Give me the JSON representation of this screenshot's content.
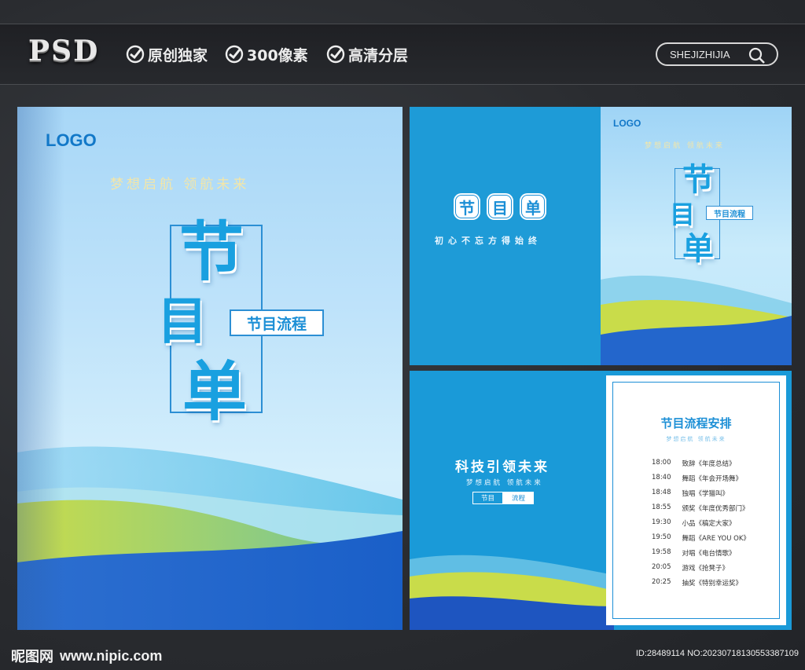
{
  "header": {
    "psd_label": "PSD",
    "features": [
      "原创独家",
      "300像素",
      "高清分层"
    ],
    "search_text": "SHEJIZHIJIA"
  },
  "cover": {
    "logo": "LOGO",
    "slogan": "梦想启航  领航未来",
    "chars": [
      "节",
      "目",
      "单"
    ],
    "tag": "节目流程"
  },
  "spread": {
    "left_chars": [
      "节",
      "目",
      "单"
    ],
    "left_slogan": "初心不忘方得始终",
    "logo": "LOGO",
    "slogan": "梦想启航  领航未来",
    "chars": [
      "节",
      "目",
      "单"
    ],
    "tag": "节目流程"
  },
  "inner": {
    "headline": "科技引领未来",
    "sub": "梦想启航  领航未来",
    "tab_a": "节目",
    "tab_b": "流程",
    "schedule_title": "节目流程安排",
    "schedule_sub": "梦想启航  领航未来",
    "rows": [
      {
        "time": "18:00",
        "item": "致辞《年度总结》"
      },
      {
        "time": "18:40",
        "item": "舞蹈《年会开场舞》"
      },
      {
        "time": "18:48",
        "item": "独唱《学猫叫》"
      },
      {
        "time": "18:55",
        "item": "颁奖《年度优秀部门》"
      },
      {
        "time": "19:30",
        "item": "小品《稿定大家》"
      },
      {
        "time": "19:50",
        "item": "舞蹈《ARE YOU OK》"
      },
      {
        "time": "19:58",
        "item": "对唱《电台情歌》"
      },
      {
        "time": "20:05",
        "item": "游戏《抢凳子》"
      },
      {
        "time": "20:25",
        "item": "抽奖《特别幸运奖》"
      }
    ]
  },
  "footer": {
    "site_brand": "昵图网",
    "site_url": "www.nipic.com",
    "id_text": "ID:28489114 NO:20230718130553387109"
  },
  "colors": {
    "accent": "#1c8fd6",
    "background": "#2b2e33"
  }
}
